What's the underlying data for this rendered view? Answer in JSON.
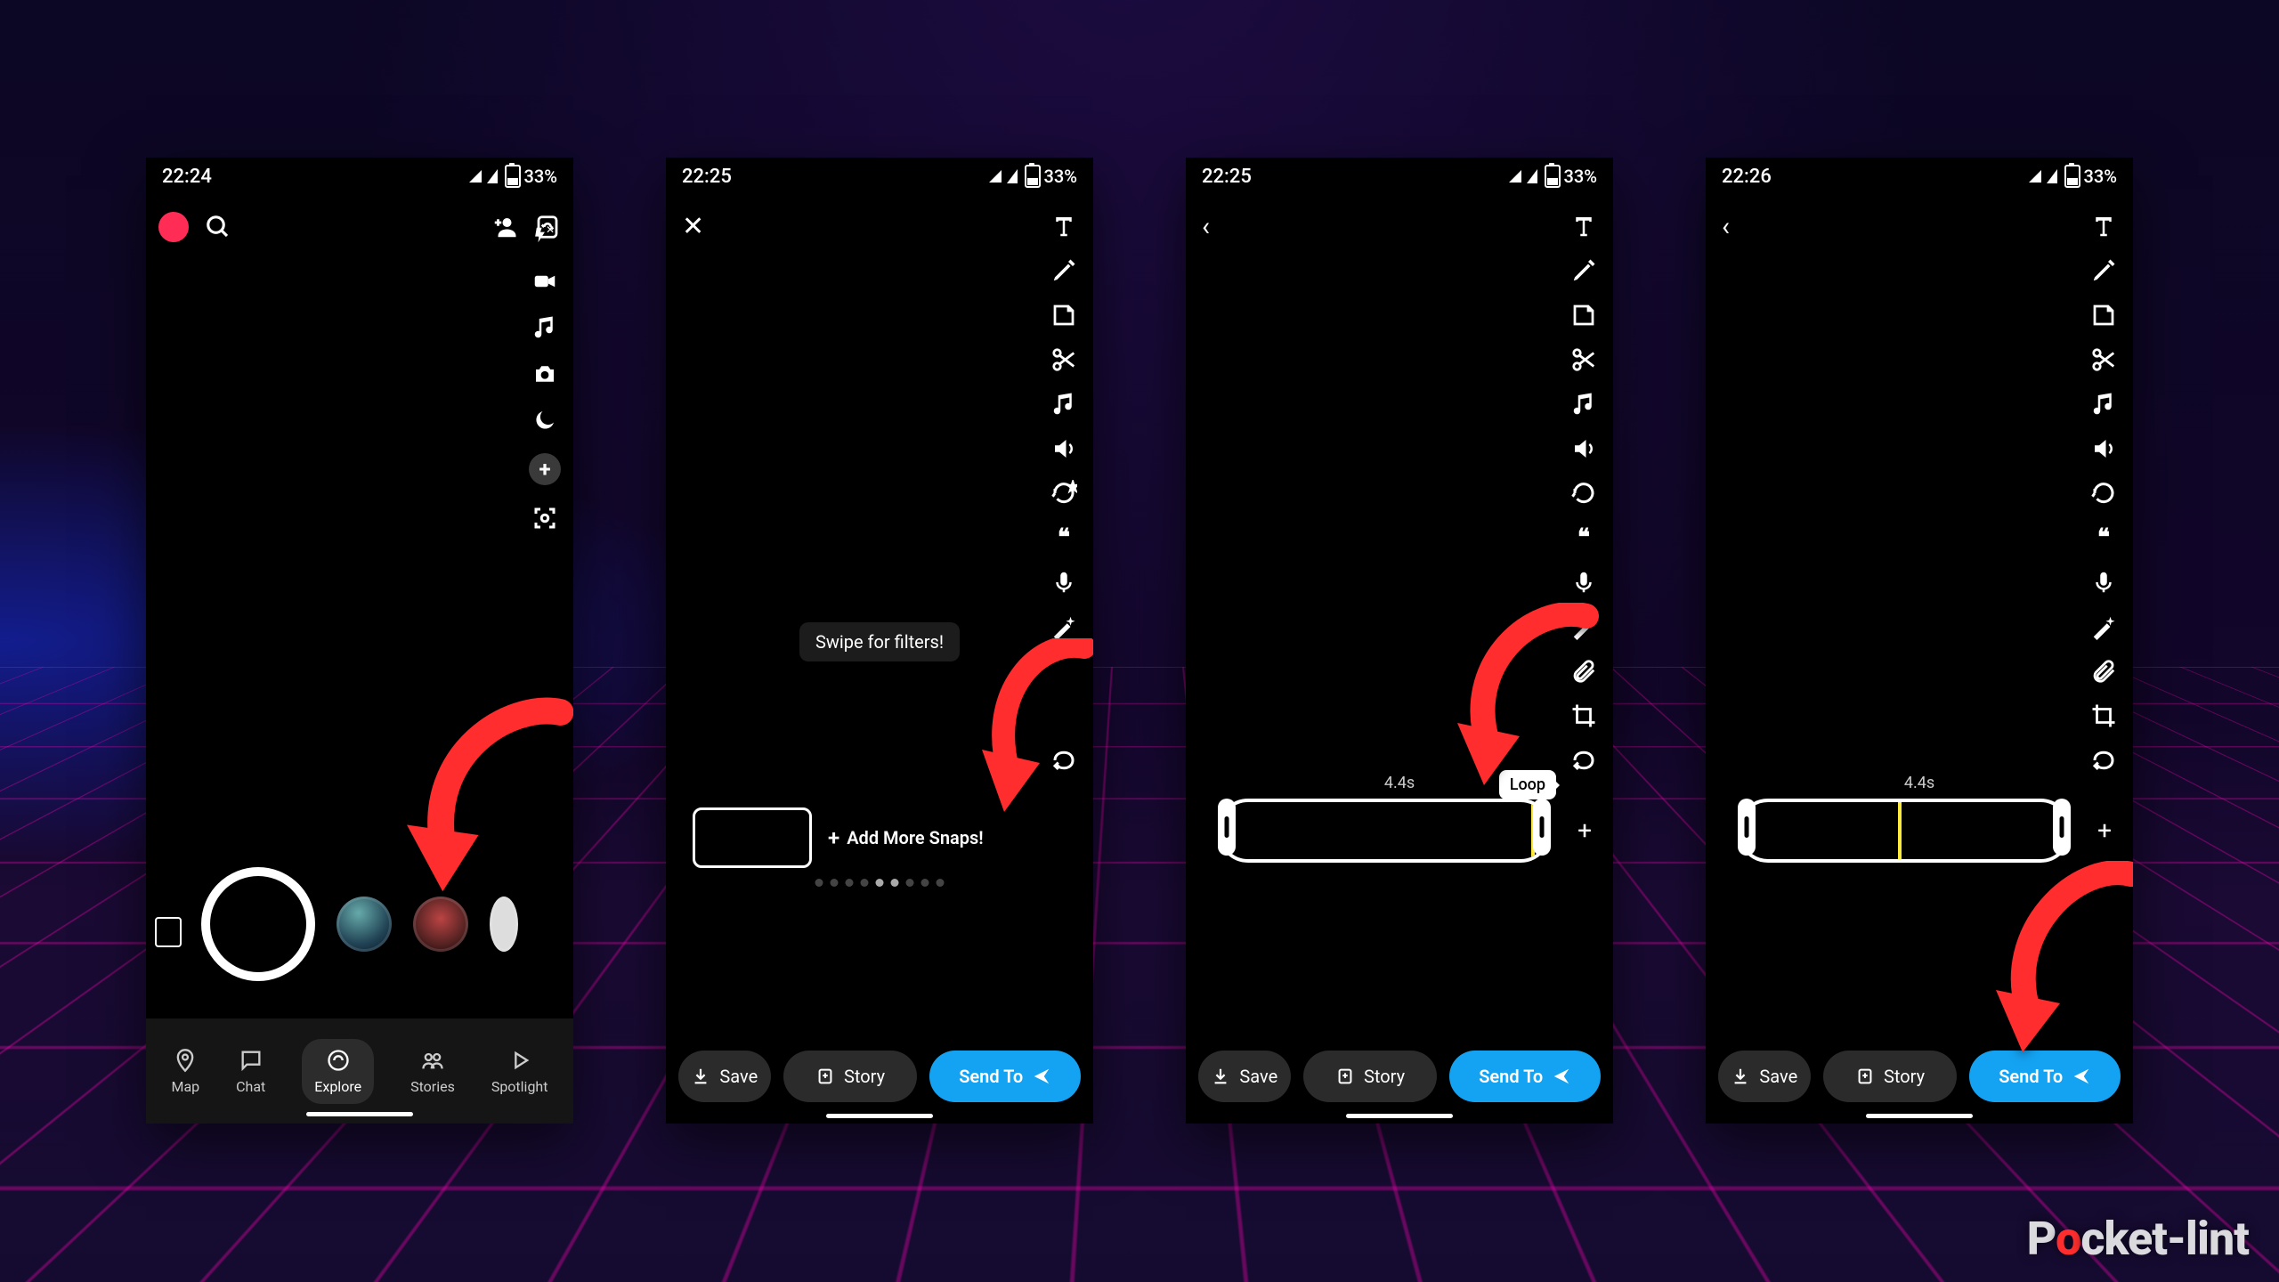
{
  "watermark": "Pocket-lint",
  "phones": [
    {
      "time": "22:24",
      "battery": "33%",
      "nav": {
        "map": "Map",
        "chat": "Chat",
        "explore": "Explore",
        "stories": "Stories",
        "spotlight": "Spotlight"
      }
    },
    {
      "time": "22:25",
      "battery": "33%",
      "tooltip": "Swipe for filters!",
      "addMore": "Add More Snaps!",
      "actions": {
        "save": "Save",
        "story": "Story",
        "send": "Send To"
      }
    },
    {
      "time": "22:25",
      "battery": "33%",
      "duration": "4.4s",
      "loop": "Loop",
      "actions": {
        "save": "Save",
        "story": "Story",
        "send": "Send To"
      }
    },
    {
      "time": "22:26",
      "battery": "33%",
      "duration": "4.4s",
      "actions": {
        "save": "Save",
        "story": "Story",
        "send": "Send To"
      }
    }
  ]
}
